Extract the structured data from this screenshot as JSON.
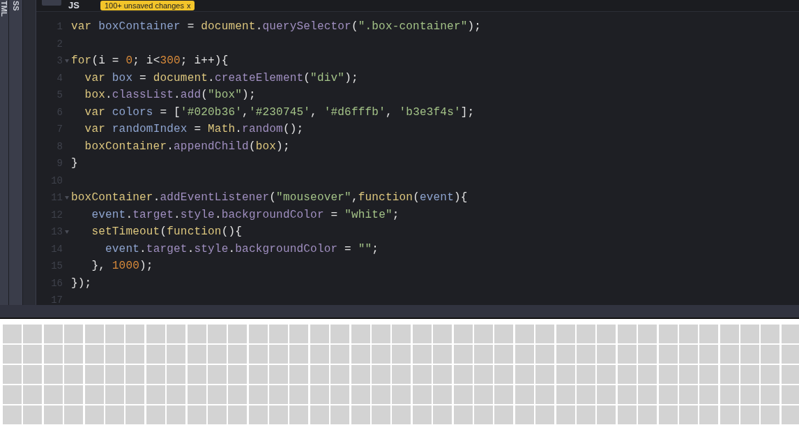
{
  "side_tabs": [
    {
      "label": "TML",
      "selected": false
    },
    {
      "label": "SS",
      "selected": false
    }
  ],
  "editor_header": {
    "tab": "JS",
    "badge": "100+ unsaved changes",
    "badge_close": "x"
  },
  "code_lines": [
    {
      "number": "1",
      "fold": false,
      "tokens": [
        {
          "kind": "kw",
          "t": "var"
        },
        {
          "kind": "var",
          "t": " boxContainer"
        },
        {
          "kind": "p",
          "t": " = "
        },
        {
          "kind": "kw",
          "t": "document"
        },
        {
          "kind": "p",
          "t": "."
        },
        {
          "kind": "prop",
          "t": "querySelector"
        },
        {
          "kind": "p",
          "t": "("
        },
        {
          "kind": "str",
          "t": "\".box-container\""
        },
        {
          "kind": "p",
          "t": ");"
        }
      ]
    },
    {
      "number": "2",
      "fold": false
    },
    {
      "number": "3",
      "fold": true,
      "tokens": [
        {
          "kind": "kw",
          "t": "for"
        },
        {
          "kind": "p",
          "t": "(i = "
        },
        {
          "kind": "num",
          "t": "0"
        },
        {
          "kind": "p",
          "t": "; i<"
        },
        {
          "kind": "num",
          "t": "300"
        },
        {
          "kind": "p",
          "t": "; i++){"
        }
      ]
    },
    {
      "number": "4",
      "fold": false,
      "tokens": [
        {
          "kind": "kw",
          "t": "  var"
        },
        {
          "kind": "var",
          "t": " box"
        },
        {
          "kind": "p",
          "t": " = "
        },
        {
          "kind": "kw",
          "t": "document"
        },
        {
          "kind": "p",
          "t": "."
        },
        {
          "kind": "prop",
          "t": "createElement"
        },
        {
          "kind": "p",
          "t": "("
        },
        {
          "kind": "str",
          "t": "\"div\""
        },
        {
          "kind": "p",
          "t": ");"
        }
      ]
    },
    {
      "number": "5",
      "fold": false,
      "tokens": [
        {
          "kind": "kw",
          "t": "  box"
        },
        {
          "kind": "p",
          "t": "."
        },
        {
          "kind": "prop",
          "t": "classList"
        },
        {
          "kind": "p",
          "t": "."
        },
        {
          "kind": "prop",
          "t": "add"
        },
        {
          "kind": "p",
          "t": "("
        },
        {
          "kind": "str",
          "t": "\"box\""
        },
        {
          "kind": "p",
          "t": ");"
        }
      ]
    },
    {
      "number": "6",
      "fold": false,
      "tokens": [
        {
          "kind": "kw",
          "t": "  var"
        },
        {
          "kind": "var",
          "t": " colors"
        },
        {
          "kind": "p",
          "t": " = ["
        },
        {
          "kind": "str",
          "t": "'#020b36'"
        },
        {
          "kind": "p",
          "t": ","
        },
        {
          "kind": "str",
          "t": "'#230745'"
        },
        {
          "kind": "p",
          "t": ", "
        },
        {
          "kind": "str",
          "t": "'#d6fffb'"
        },
        {
          "kind": "p",
          "t": ", "
        },
        {
          "kind": "str",
          "t": "'b3e3f4s'"
        },
        {
          "kind": "p",
          "t": "];"
        }
      ]
    },
    {
      "number": "7",
      "fold": false,
      "tokens": [
        {
          "kind": "kw",
          "t": "  var"
        },
        {
          "kind": "var",
          "t": " randomIndex"
        },
        {
          "kind": "p",
          "t": " = "
        },
        {
          "kind": "kw",
          "t": "Math"
        },
        {
          "kind": "p",
          "t": "."
        },
        {
          "kind": "prop",
          "t": "random"
        },
        {
          "kind": "p",
          "t": "();"
        }
      ]
    },
    {
      "number": "8",
      "fold": false,
      "tokens": [
        {
          "kind": "kw",
          "t": "  boxContainer"
        },
        {
          "kind": "p",
          "t": "."
        },
        {
          "kind": "prop",
          "t": "appendChild"
        },
        {
          "kind": "p",
          "t": "("
        },
        {
          "kind": "kw",
          "t": "box"
        },
        {
          "kind": "p",
          "t": ");"
        }
      ]
    },
    {
      "number": "9",
      "fold": false,
      "tokens": [
        {
          "kind": "p",
          "t": "}"
        }
      ]
    },
    {
      "number": "10",
      "fold": false
    },
    {
      "number": "11",
      "fold": true,
      "tokens": [
        {
          "kind": "kw",
          "t": "boxContainer"
        },
        {
          "kind": "p",
          "t": "."
        },
        {
          "kind": "prop",
          "t": "addEventListener"
        },
        {
          "kind": "p",
          "t": "("
        },
        {
          "kind": "str",
          "t": "\"mouseover\""
        },
        {
          "kind": "p",
          "t": ","
        },
        {
          "kind": "kw",
          "t": "function"
        },
        {
          "kind": "p",
          "t": "("
        },
        {
          "kind": "var",
          "t": "event"
        },
        {
          "kind": "p",
          "t": "){"
        }
      ]
    },
    {
      "number": "12",
      "fold": false,
      "tokens": [
        {
          "kind": "var",
          "t": "   event"
        },
        {
          "kind": "p",
          "t": "."
        },
        {
          "kind": "prop",
          "t": "target"
        },
        {
          "kind": "p",
          "t": "."
        },
        {
          "kind": "prop",
          "t": "style"
        },
        {
          "kind": "p",
          "t": "."
        },
        {
          "kind": "prop",
          "t": "backgroundColor"
        },
        {
          "kind": "p",
          "t": " = "
        },
        {
          "kind": "str",
          "t": "\"white\""
        },
        {
          "kind": "p",
          "t": ";"
        }
      ]
    },
    {
      "number": "13",
      "fold": true,
      "tokens": [
        {
          "kind": "kw",
          "t": "   setTimeout"
        },
        {
          "kind": "p",
          "t": "("
        },
        {
          "kind": "kw",
          "t": "function"
        },
        {
          "kind": "p",
          "t": "(){"
        }
      ]
    },
    {
      "number": "14",
      "fold": false,
      "tokens": [
        {
          "kind": "var",
          "t": "     event"
        },
        {
          "kind": "p",
          "t": "."
        },
        {
          "kind": "prop",
          "t": "target"
        },
        {
          "kind": "p",
          "t": "."
        },
        {
          "kind": "prop",
          "t": "style"
        },
        {
          "kind": "p",
          "t": "."
        },
        {
          "kind": "prop",
          "t": "backgroundColor"
        },
        {
          "kind": "p",
          "t": " = "
        },
        {
          "kind": "str",
          "t": "\"\""
        },
        {
          "kind": "p",
          "t": ";"
        }
      ]
    },
    {
      "number": "15",
      "fold": false,
      "tokens": [
        {
          "kind": "p",
          "t": "   }, "
        },
        {
          "kind": "num",
          "t": "1000"
        },
        {
          "kind": "p",
          "t": ");"
        }
      ]
    },
    {
      "number": "16",
      "fold": false,
      "tokens": [
        {
          "kind": "p",
          "t": "});"
        }
      ]
    },
    {
      "number": "17",
      "fold": false
    }
  ],
  "preview": {
    "kind": "box-grid"
  }
}
